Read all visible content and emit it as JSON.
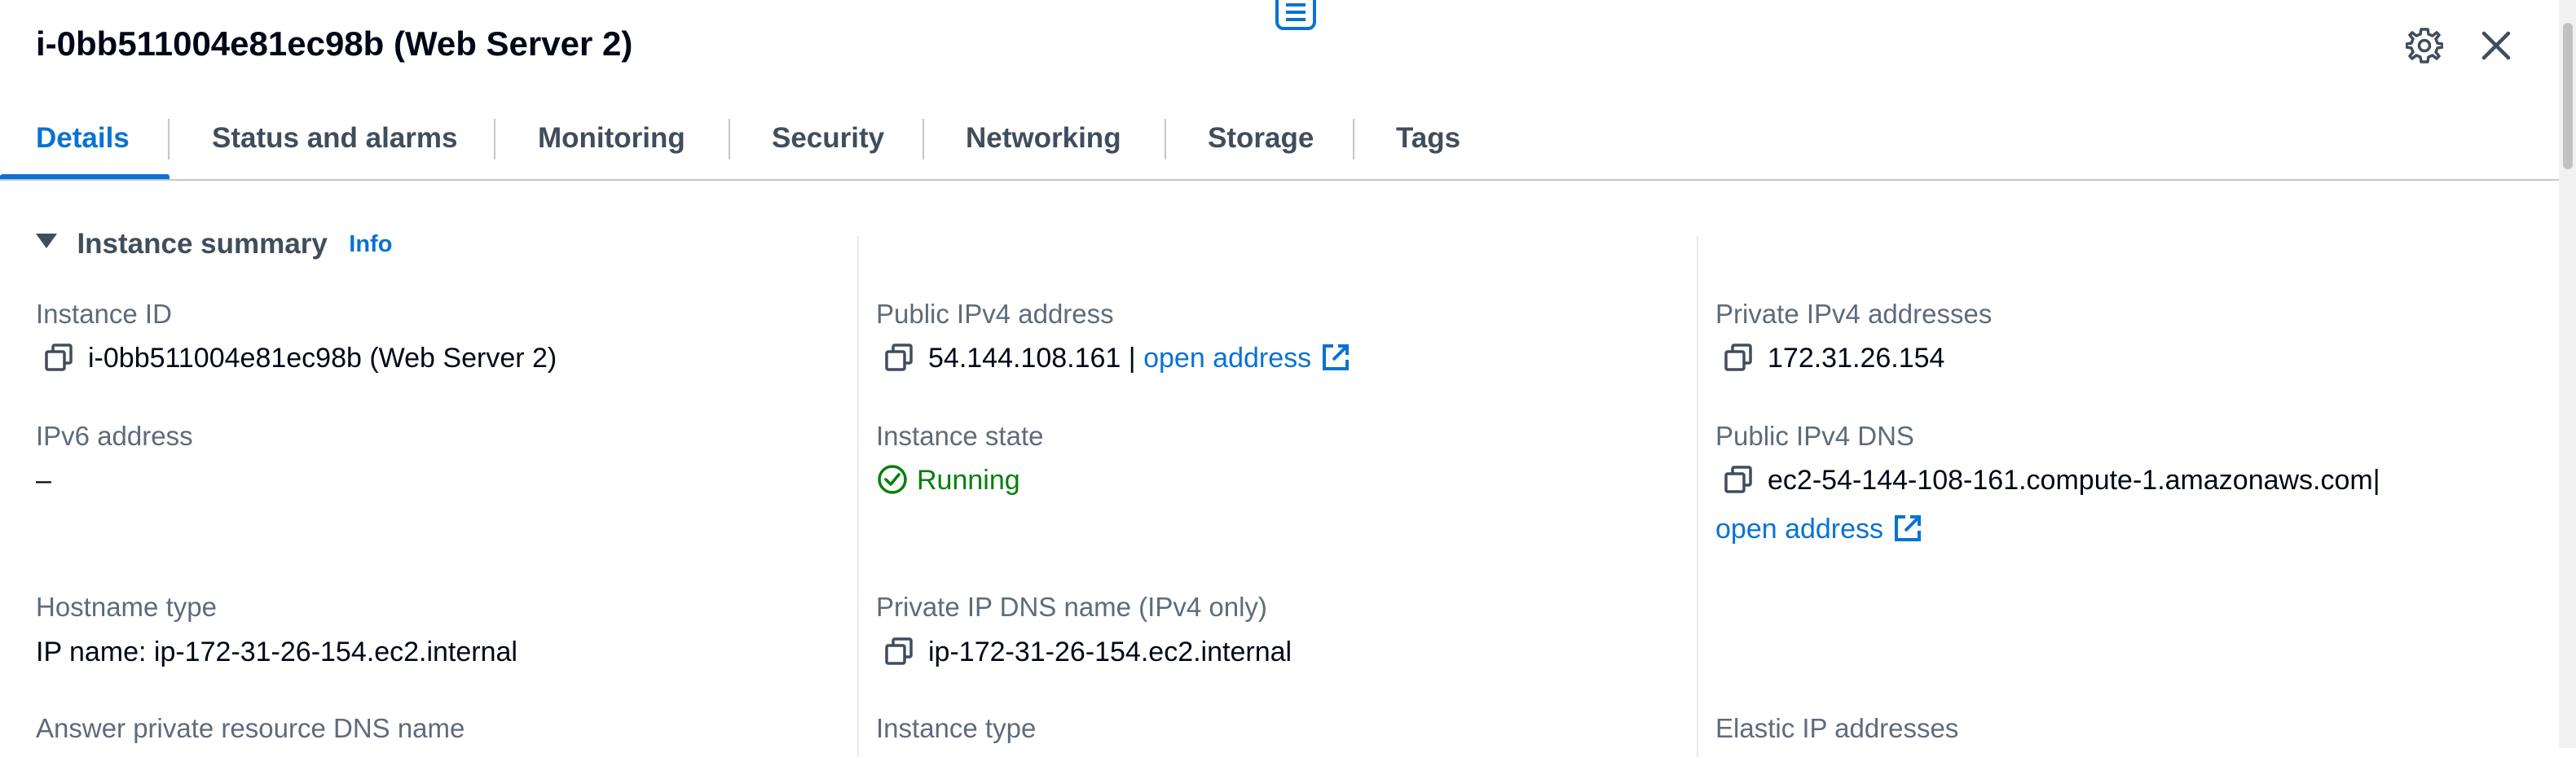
{
  "header": {
    "title": "i-0bb511004e81ec98b (Web Server 2)"
  },
  "tabs": [
    {
      "label": "Details",
      "active": true
    },
    {
      "label": "Status and alarms"
    },
    {
      "label": "Monitoring"
    },
    {
      "label": "Security"
    },
    {
      "label": "Networking"
    },
    {
      "label": "Storage"
    },
    {
      "label": "Tags"
    }
  ],
  "section": {
    "title": "Instance summary",
    "info": "Info"
  },
  "fields": {
    "instance_id": {
      "label": "Instance ID",
      "value": "i-0bb511004e81ec98b (Web Server 2)"
    },
    "public_ipv4": {
      "label": "Public IPv4 address",
      "value": "54.144.108.161",
      "separator": "|",
      "link": "open address"
    },
    "private_ipv4": {
      "label": "Private IPv4 addresses",
      "value": "172.31.26.154"
    },
    "ipv6": {
      "label": "IPv6 address",
      "value": "–"
    },
    "instance_state": {
      "label": "Instance state",
      "value": "Running"
    },
    "public_dns": {
      "label": "Public IPv4 DNS",
      "value": "ec2-54-144-108-161.compute-1.amazonaws.com",
      "separator": "|",
      "link": "open address"
    },
    "hostname_type": {
      "label": "Hostname type",
      "value": "IP name: ip-172-31-26-154.ec2.internal"
    },
    "private_dns": {
      "label": "Private IP DNS name (IPv4 only)",
      "value": "ip-172-31-26-154.ec2.internal"
    },
    "answer_dns": {
      "label": "Answer private resource DNS name"
    },
    "instance_type": {
      "label": "Instance type"
    },
    "elastic_ip": {
      "label": "Elastic IP addresses"
    }
  },
  "colors": {
    "accent": "#0972d3",
    "success": "#037f0c",
    "label": "#5f6b7a",
    "text": "#000716"
  }
}
